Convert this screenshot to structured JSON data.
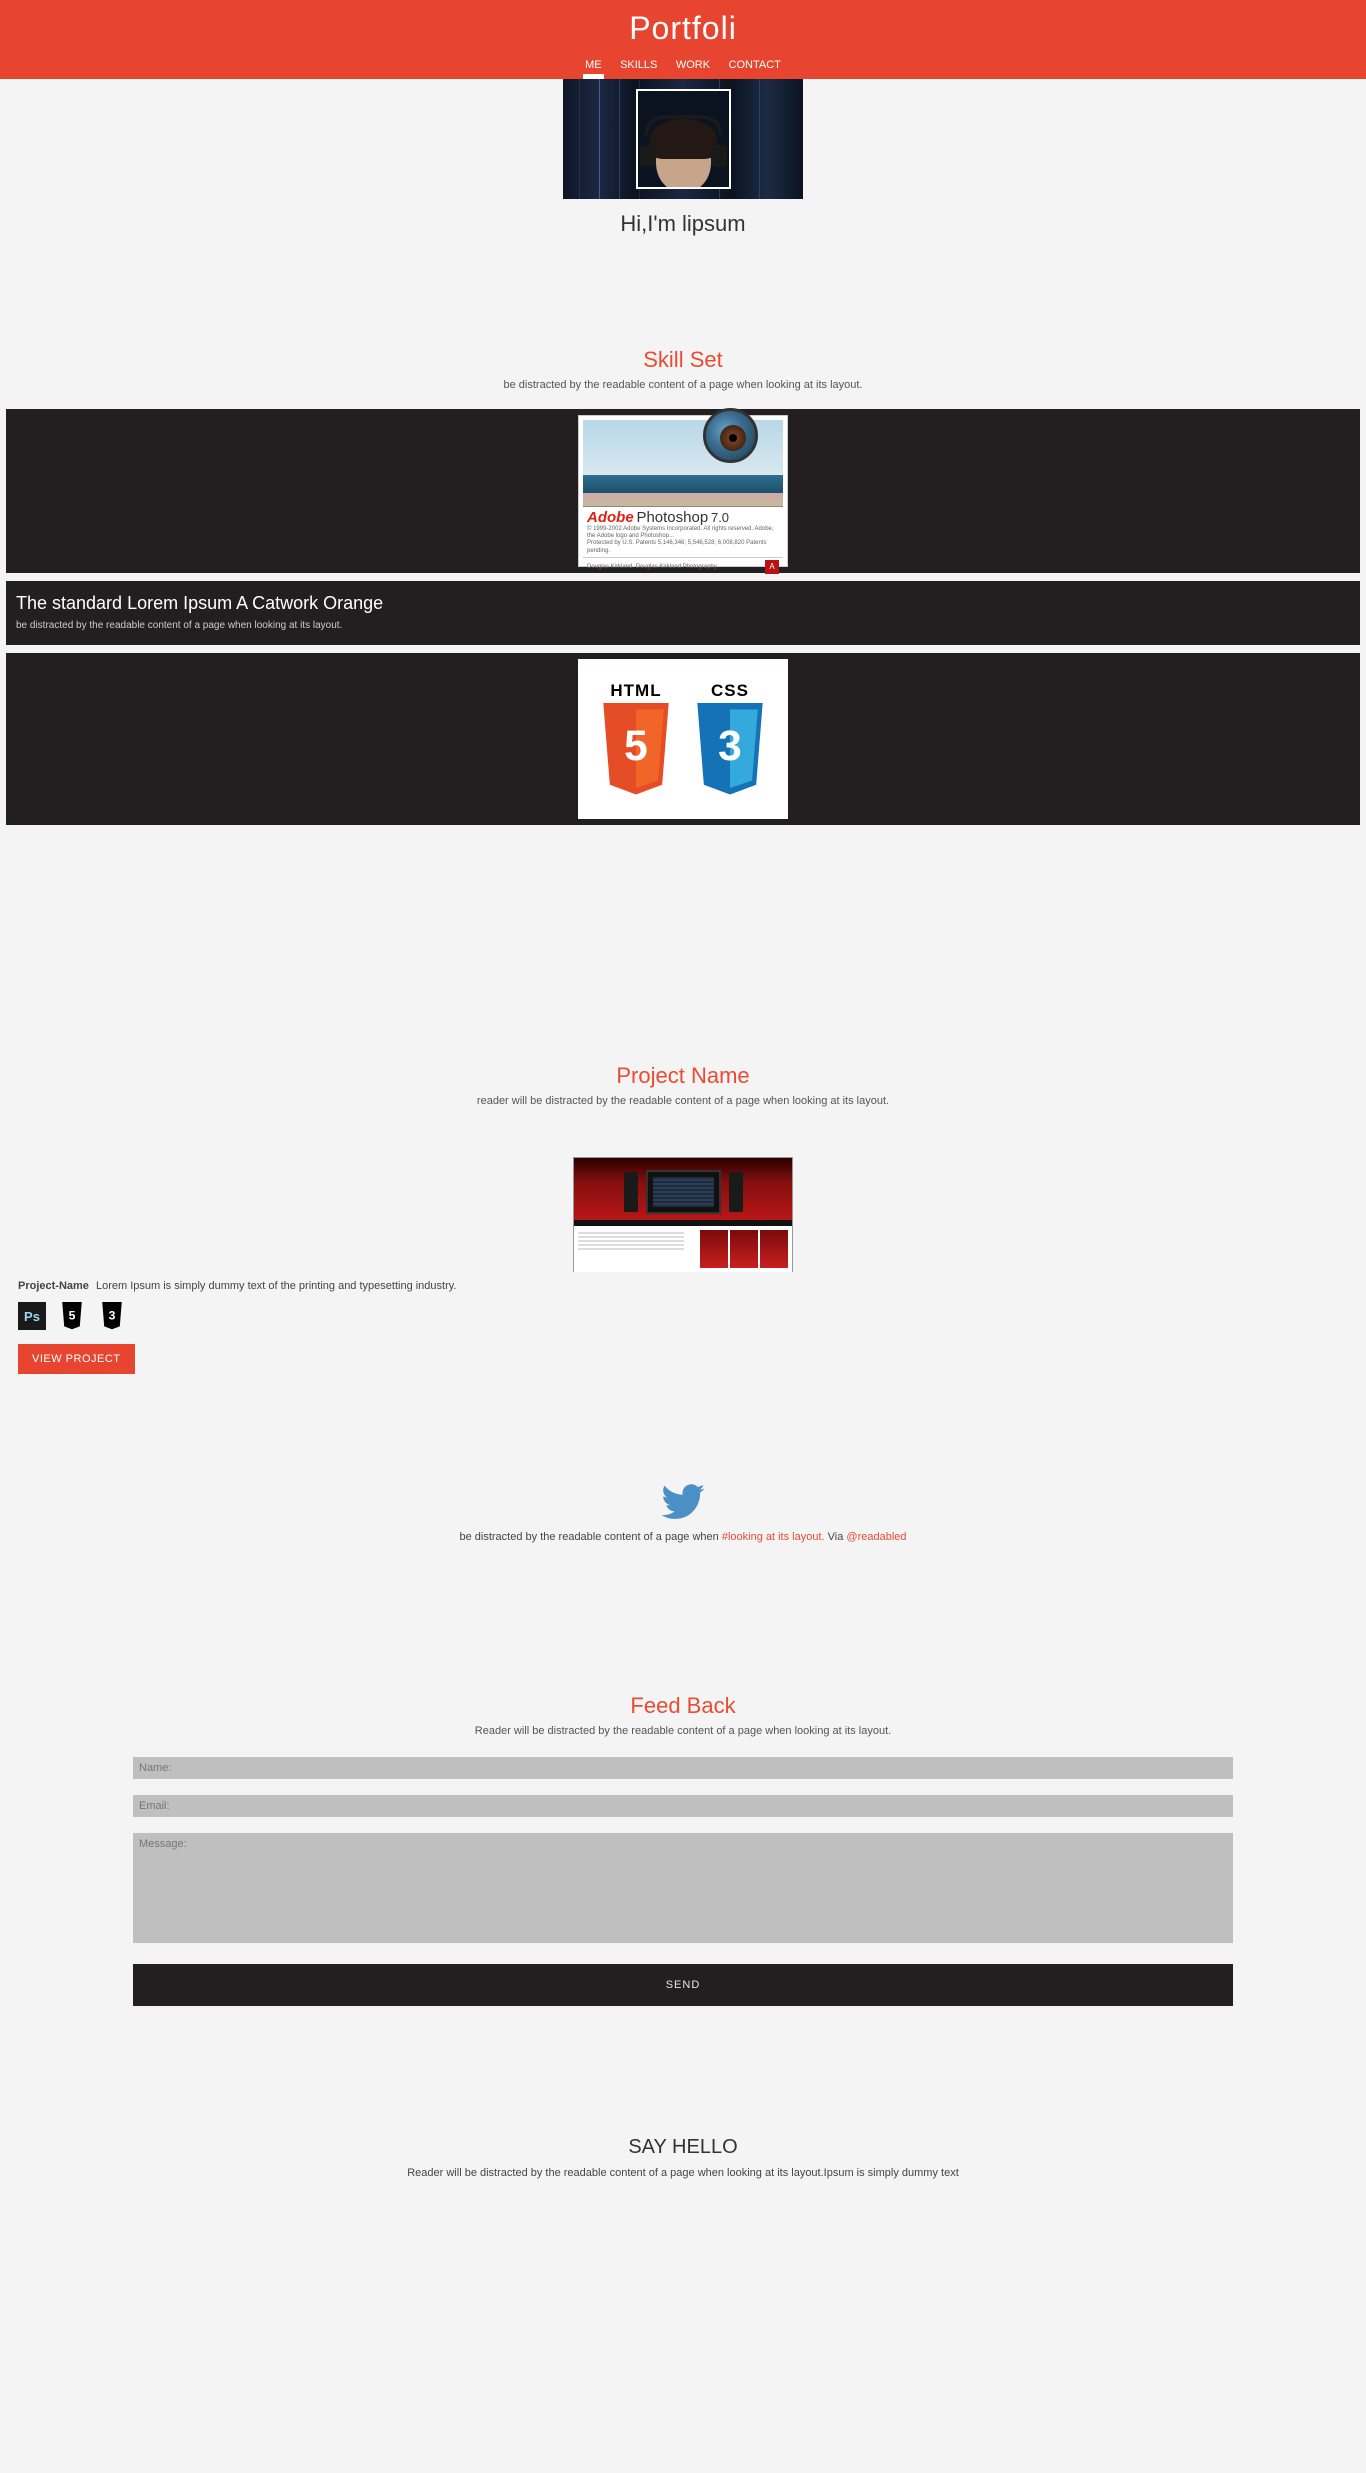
{
  "header": {
    "logo": "Portfoli",
    "nav": [
      "ME",
      "SKILLS",
      "WORK",
      "CONTACT"
    ],
    "active": 0
  },
  "me": {
    "greeting": "Hi,I'm lipsum"
  },
  "skills": {
    "title": "Skill Set",
    "sub": "be distracted by the readable content of a page when looking at its layout.",
    "card1": {
      "brand_a": "Adobe",
      "brand_b": "Photoshop",
      "version": "7.0",
      "copy1": "© 1999-2002 Adobe Systems Incorporated. All rights reserved. Adobe, the Adobe logo and Photoshop...",
      "copy2": "Protected by U.S. Patents 5,146,346; 5,546,528; 6,008,820 Patents pending.",
      "foot_left": "Douglas Kirkland, Douglas Kirkland Photography",
      "adobe_sq": "A"
    },
    "text_block": {
      "heading": "The standard Lorem Ipsum A Catwork Orange",
      "sub": "be distracted by the readable content of a page when looking at its layout."
    },
    "card2": {
      "label_html": "HTML",
      "label_css": "CSS",
      "five": "5",
      "three": "3"
    }
  },
  "work": {
    "title": "Project Name",
    "sub": "reader will be distracted by the readable content of a page when looking at its layout.",
    "desc_label": "Project-Name",
    "desc": "Lorem Ipsum is simply dummy text of the printing and typesetting industry.",
    "tool_ps": "Ps",
    "view_btn": "VIEW PROJECT"
  },
  "tweet": {
    "pre": "be distracted by the readable content of a page when ",
    "hash": "#looking at its layout.",
    "via": " Via ",
    "at": "@readabled"
  },
  "feedback": {
    "title": "Feed Back",
    "sub": "Reader will be distracted by the readable content of a page when looking at its layout.",
    "name_ph": "Name:",
    "email_ph": "Email:",
    "msg_ph": "Message:",
    "send": "SEND"
  },
  "hello": {
    "title": "SAY HELLO",
    "sub": "Reader will be distracted by the readable content of a page when looking at its layout.Ipsum is simply dummy text"
  }
}
